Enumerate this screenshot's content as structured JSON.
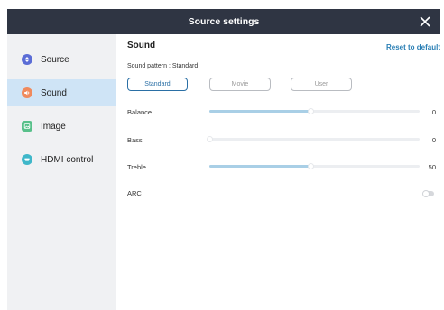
{
  "window": {
    "title": "Source settings"
  },
  "sidebar": {
    "items": [
      {
        "label": "Source",
        "icon": "source-icon",
        "color": "#5b6dd6",
        "active": false
      },
      {
        "label": "Sound",
        "icon": "sound-icon",
        "color": "#f08a5d",
        "active": true
      },
      {
        "label": "Image",
        "icon": "image-icon",
        "color": "#58c08a",
        "active": false
      },
      {
        "label": "HDMI control",
        "icon": "hdmi-control-icon",
        "color": "#3fb7c9",
        "active": false
      }
    ]
  },
  "main": {
    "section_title": "Sound",
    "reset_label": "Reset to default",
    "pattern": {
      "label": "Sound pattern",
      "separator": ":",
      "current": "Standard",
      "options": [
        "Standard",
        "Movie",
        "User"
      ],
      "selected": "Standard"
    },
    "sliders": [
      {
        "label": "Balance",
        "value": "0",
        "fill": 0.48
      },
      {
        "label": "Bass",
        "value": "0",
        "fill": 0.0
      },
      {
        "label": "Treble",
        "value": "50",
        "fill": 0.48
      }
    ],
    "arc": {
      "label": "ARC",
      "enabled": false
    }
  },
  "colors": {
    "titlebar": "#2f3543",
    "accent": "#2a7fb5",
    "active_item": "#cfe4f6",
    "slider_fill": "#a9cfe6"
  }
}
